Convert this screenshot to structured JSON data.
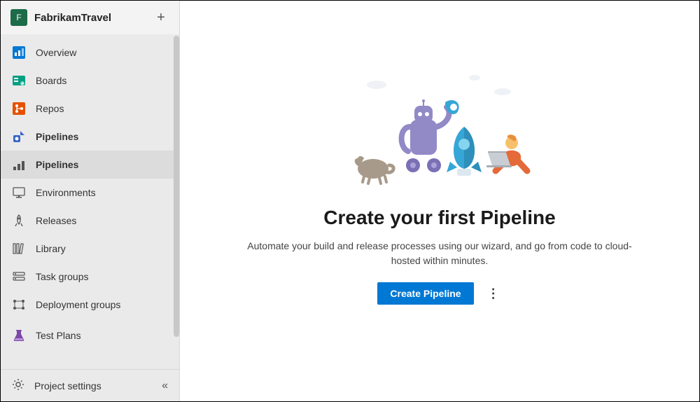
{
  "project": {
    "avatar_letter": "F",
    "name": "FabrikamTravel"
  },
  "sidebar": {
    "items": [
      {
        "icon": "overview-icon",
        "label": "Overview",
        "color": "#0078d4"
      },
      {
        "icon": "boards-icon",
        "label": "Boards",
        "color": "#009e82"
      },
      {
        "icon": "repos-icon",
        "label": "Repos",
        "color": "#e55100"
      },
      {
        "icon": "pipelines-icon",
        "label": "Pipelines",
        "color": "#3666c9"
      }
    ],
    "sub_items": [
      {
        "icon": "pipelines-sub-icon",
        "label": "Pipelines"
      },
      {
        "icon": "environments-icon",
        "label": "Environments"
      },
      {
        "icon": "releases-icon",
        "label": "Releases"
      },
      {
        "icon": "library-icon",
        "label": "Library"
      },
      {
        "icon": "task-groups-icon",
        "label": "Task groups"
      },
      {
        "icon": "deployment-groups-icon",
        "label": "Deployment groups"
      }
    ],
    "lower_items": [
      {
        "icon": "test-plans-icon",
        "label": "Test Plans",
        "color": "#7b49a6"
      }
    ],
    "footer": {
      "label": "Project settings"
    }
  },
  "main": {
    "heading": "Create your first Pipeline",
    "subheading": "Automate your build and release processes using our wizard, and go from code to cloud-hosted within minutes.",
    "primary_button": "Create Pipeline"
  }
}
